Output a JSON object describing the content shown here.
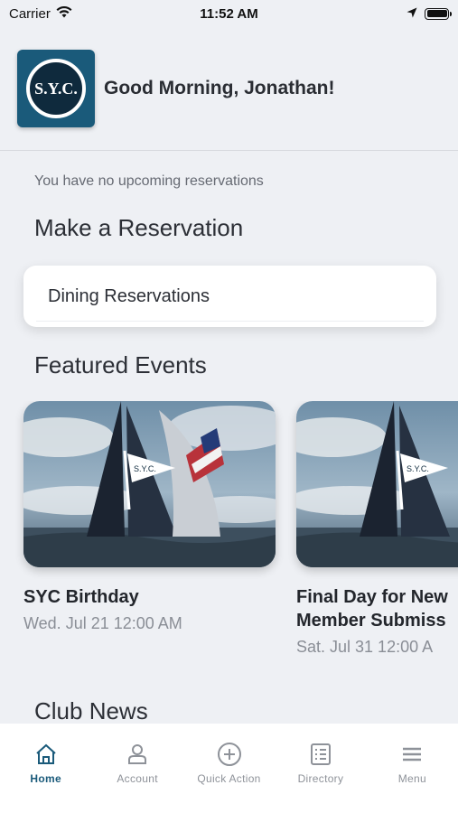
{
  "status_bar": {
    "carrier": "Carrier",
    "time": "11:52 AM"
  },
  "header": {
    "logo_text": "S.Y.C.",
    "greeting": "Good Morning, Jonathan!"
  },
  "reservations": {
    "empty_message": "You have no upcoming reservations",
    "make_title": "Make a Reservation",
    "dining_label": "Dining Reservations"
  },
  "featured": {
    "title": "Featured Events",
    "events": [
      {
        "title": "SYC Birthday",
        "date": "Wed. Jul 21 12:00 AM"
      },
      {
        "title": "Final Day for New\nMember Submiss",
        "date": "Sat. Jul 31 12:00 A"
      }
    ],
    "flag_text": "S.Y.C."
  },
  "news": {
    "title": "Club News"
  },
  "tab_bar": {
    "tabs": [
      {
        "label": "Home",
        "icon": "home-icon",
        "active": true
      },
      {
        "label": "Account",
        "icon": "account-icon",
        "active": false
      },
      {
        "label": "Quick Action",
        "icon": "plus-circle-icon",
        "active": false
      },
      {
        "label": "Directory",
        "icon": "list-icon",
        "active": false
      },
      {
        "label": "Menu",
        "icon": "hamburger-icon",
        "active": false
      }
    ]
  },
  "colors": {
    "brand": "#1a5a7a",
    "background": "#eef0f4",
    "inactive_tab": "#8e9299"
  }
}
